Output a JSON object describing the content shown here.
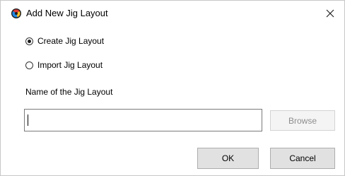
{
  "dialog": {
    "title": "Add New Jig Layout",
    "app_icon": "jig-app-icon",
    "close_icon": "close-icon"
  },
  "options": {
    "create_label": "Create Jig Layout",
    "create_selected": true,
    "import_label": "Import Jig Layout",
    "import_selected": false
  },
  "name_field": {
    "label": "Name of the Jig Layout",
    "value": ""
  },
  "buttons": {
    "browse_label": "Browse",
    "ok_label": "OK",
    "cancel_label": "Cancel"
  },
  "colors": {
    "button_face": "#e1e1e1",
    "button_border": "#adadad",
    "disabled_text": "#8d8d8d",
    "input_border": "#7a7a7a"
  }
}
